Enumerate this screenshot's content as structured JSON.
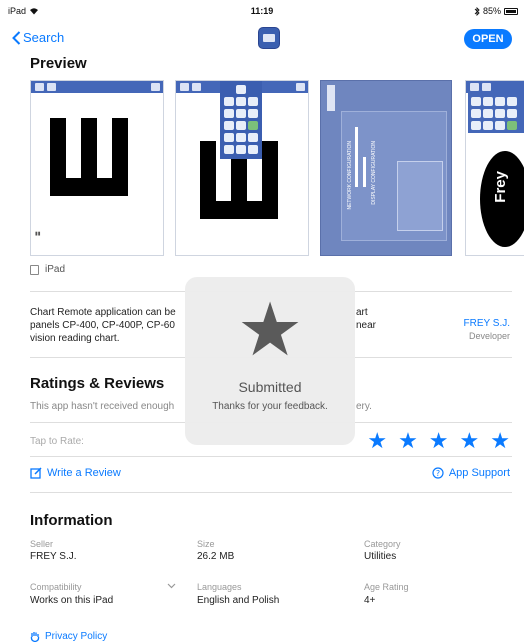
{
  "status": {
    "device": "iPad",
    "time": "11:19",
    "battery": "85%"
  },
  "nav": {
    "back_label": "Search",
    "open_label": "OPEN"
  },
  "preview": {
    "title": "Preview",
    "device_label": "iPad",
    "shot3_text": [
      "NETWORK CONFIGURATION",
      "DISPLAY CONFIGURATION"
    ],
    "shot4_text": "Frey"
  },
  "description": {
    "line1_left": "Chart Remote application can be",
    "line1_right": "art",
    "line2_left": "panels CP-400, CP-400P, CP-60",
    "line2_right": "near",
    "line3": "vision reading chart.",
    "developer": "FREY S.J.",
    "developer_role": "Developer"
  },
  "ratings": {
    "title": "Ratings & Reviews",
    "note_left": "This app hasn't received enough",
    "note_right": "ery.",
    "tap_to_rate": "Tap to Rate:",
    "write_review": "Write a Review",
    "app_support": "App Support"
  },
  "information": {
    "title": "Information",
    "seller_label": "Seller",
    "seller": "FREY S.J.",
    "size_label": "Size",
    "size": "26.2 MB",
    "category_label": "Category",
    "category": "Utilities",
    "compat_label": "Compatibility",
    "compat": "Works on this iPad",
    "languages_label": "Languages",
    "languages": "English and Polish",
    "age_label": "Age Rating",
    "age": "4+",
    "privacy": "Privacy Policy"
  },
  "hud": {
    "title": "Submitted",
    "subtitle": "Thanks for your feedback."
  },
  "colors": {
    "accent": "#0a7aff",
    "chart_bar": "#4467b8",
    "hud_bg": "#ececec"
  }
}
